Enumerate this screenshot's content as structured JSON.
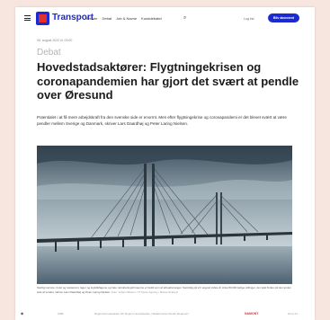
{
  "header": {
    "brand": "Transport",
    "nav": [
      "Artikler",
      "Debat",
      "Job & Navne",
      "Kunddebatet"
    ],
    "login": "Log ind",
    "subscribe": "Bliv abonnent"
  },
  "article": {
    "date": "05. august 2022 kl. 09:00",
    "kicker": "Debat",
    "headline": "Hovedstadsaktører: Flygtningekrisen og coronapandemien har gjort det svært at pendle over Øresund",
    "lead": "Potentialet i at få mere arbejdskraft fra den svenske side er enormt. Men efter flygtningekrise og coronapandemi er det blevet svært at være pendler mellem Sverige og Danmark, skriver Lars Daardhøj og Peter Laring Nielsen.",
    "caption": "Særligt service, hotel og restaurant, lager og logistikfagene og hele rekrutteringsfirmaerne er fældt som af arbejdsmangel. Samtidig på vil i august sidste år cirka 80.000 ledige stillinger, der skal findes på den anden side af sundet, skriver Lars Daardhøj og Peter Laring Nielsen.",
    "credit": "Foto: Johan Nilsson / TT News Agency / Ritzau Scanpix"
  },
  "footer": {
    "left_text": "CØB",
    "middle_text": "Regionshovedstaden DK  Region Hovedstaden  |  Skattforvaret Steder Regionen",
    "brand": "NAMONT",
    "right_text": "Hit st d1"
  },
  "colors": {
    "brand_blue": "#1b2bd1",
    "brand_red": "#e0312b",
    "page_bg": "#f7e6df"
  }
}
